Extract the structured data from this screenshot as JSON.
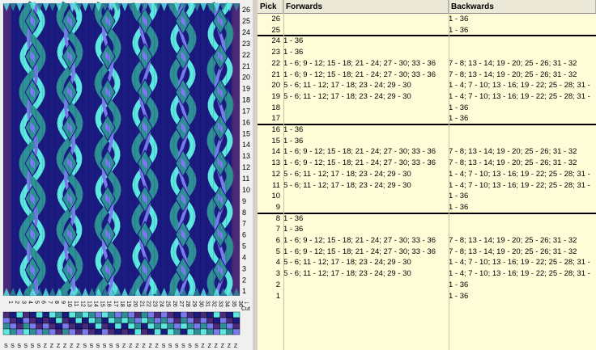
{
  "colors": {
    "navy": "#1a1a80",
    "teal": "#2f8f97",
    "cyan": "#5ce8e0",
    "lavender": "#7a7aee",
    "purple": "#4b2a7a",
    "dark": "#101060",
    "table_bg": "#fffdd8",
    "header_bg": "#ece9d8"
  },
  "pattern": {
    "left_numbers": [
      "26",
      "25",
      "24",
      "23",
      "22",
      "21",
      "20",
      "19",
      "18",
      "17",
      "16",
      "15",
      "14",
      "13",
      "12",
      "11",
      "10",
      "9",
      "8",
      "7",
      "6",
      "5",
      "4",
      "3",
      "2",
      "1"
    ],
    "card_numbers": [
      "1",
      "2",
      "3",
      "4",
      "5",
      "6",
      "7",
      "8",
      "9",
      "10",
      "11",
      "12",
      "13",
      "14",
      "15",
      "16",
      "17",
      "18",
      "19",
      "20",
      "21",
      "22",
      "23",
      "24",
      "25",
      "26",
      "27",
      "28",
      "29",
      "30",
      "31",
      "32",
      "33",
      "34",
      "35",
      "36"
    ],
    "cut_label": "Cut",
    "thread_direction": [
      "S",
      "S",
      "S",
      "S",
      "S",
      "S",
      "Z",
      "Z",
      "Z",
      "Z",
      "Z",
      "Z",
      "S",
      "S",
      "S",
      "S",
      "S",
      "S",
      "Z",
      "Z",
      "Z",
      "Z",
      "Z",
      "Z",
      "S",
      "S",
      "S",
      "S",
      "S",
      "S",
      "Z",
      "Z",
      "Z",
      "Z",
      "Z",
      "Z"
    ]
  },
  "table": {
    "headers": {
      "pick": "Pick",
      "forwards": "Forwards",
      "backwards": "Backwards"
    },
    "rows": [
      {
        "pick": "26",
        "fwd": "",
        "bwd": "1 - 36"
      },
      {
        "pick": "25",
        "fwd": "",
        "bwd": "1 - 36"
      },
      {
        "pick": "24",
        "fwd": "1 - 36",
        "bwd": ""
      },
      {
        "pick": "23",
        "fwd": "1 - 36",
        "bwd": ""
      },
      {
        "pick": "22",
        "fwd": "1 - 6; 9 - 12; 15 - 18; 21 - 24; 27 - 30; 33 - 36",
        "bwd": "7 - 8; 13 - 14; 19 - 20; 25 - 26; 31 - 32"
      },
      {
        "pick": "21",
        "fwd": "1 - 6; 9 - 12; 15 - 18; 21 - 24; 27 - 30; 33 - 36",
        "bwd": "7 - 8; 13 - 14; 19 - 20; 25 - 26; 31 - 32"
      },
      {
        "pick": "20",
        "fwd": "5 - 6; 11 - 12; 17 - 18; 23 - 24; 29 - 30",
        "bwd": "1 - 4; 7 - 10; 13 - 16; 19 - 22; 25 - 28; 31 -"
      },
      {
        "pick": "19",
        "fwd": "5 - 6; 11 - 12; 17 - 18; 23 - 24; 29 - 30",
        "bwd": "1 - 4; 7 - 10; 13 - 16; 19 - 22; 25 - 28; 31 -"
      },
      {
        "pick": "18",
        "fwd": "",
        "bwd": "1 - 36"
      },
      {
        "pick": "17",
        "fwd": "",
        "bwd": "1 - 36"
      },
      {
        "pick": "16",
        "fwd": "1 - 36",
        "bwd": ""
      },
      {
        "pick": "15",
        "fwd": "1 - 36",
        "bwd": ""
      },
      {
        "pick": "14",
        "fwd": "1 - 6; 9 - 12; 15 - 18; 21 - 24; 27 - 30; 33 - 36",
        "bwd": "7 - 8; 13 - 14; 19 - 20; 25 - 26; 31 - 32"
      },
      {
        "pick": "13",
        "fwd": "1 - 6; 9 - 12; 15 - 18; 21 - 24; 27 - 30; 33 - 36",
        "bwd": "7 - 8; 13 - 14; 19 - 20; 25 - 26; 31 - 32"
      },
      {
        "pick": "12",
        "fwd": "5 - 6; 11 - 12; 17 - 18; 23 - 24; 29 - 30",
        "bwd": "1 - 4; 7 - 10; 13 - 16; 19 - 22; 25 - 28; 31 -"
      },
      {
        "pick": "11",
        "fwd": "5 - 6; 11 - 12; 17 - 18; 23 - 24; 29 - 30",
        "bwd": "1 - 4; 7 - 10; 13 - 16; 19 - 22; 25 - 28; 31 -"
      },
      {
        "pick": "10",
        "fwd": "",
        "bwd": "1 - 36"
      },
      {
        "pick": "9",
        "fwd": "",
        "bwd": "1 - 36"
      },
      {
        "pick": "8",
        "fwd": "1 - 36",
        "bwd": ""
      },
      {
        "pick": "7",
        "fwd": "1 - 36",
        "bwd": ""
      },
      {
        "pick": "6",
        "fwd": "1 - 6; 9 - 12; 15 - 18; 21 - 24; 27 - 30; 33 - 36",
        "bwd": "7 - 8; 13 - 14; 19 - 20; 25 - 26; 31 - 32"
      },
      {
        "pick": "5",
        "fwd": "1 - 6; 9 - 12; 15 - 18; 21 - 24; 27 - 30; 33 - 36",
        "bwd": "7 - 8; 13 - 14; 19 - 20; 25 - 26; 31 - 32"
      },
      {
        "pick": "4",
        "fwd": "5 - 6; 11 - 12; 17 - 18; 23 - 24; 29 - 30",
        "bwd": "1 - 4; 7 - 10; 13 - 16; 19 - 22; 25 - 28; 31 -"
      },
      {
        "pick": "3",
        "fwd": "5 - 6; 11 - 12; 17 - 18; 23 - 24; 29 - 30",
        "bwd": "1 - 4; 7 - 10; 13 - 16; 19 - 22; 25 - 28; 31 -"
      },
      {
        "pick": "2",
        "fwd": "",
        "bwd": "1 - 36"
      },
      {
        "pick": "1",
        "fwd": "",
        "bwd": "1 - 36"
      }
    ]
  }
}
